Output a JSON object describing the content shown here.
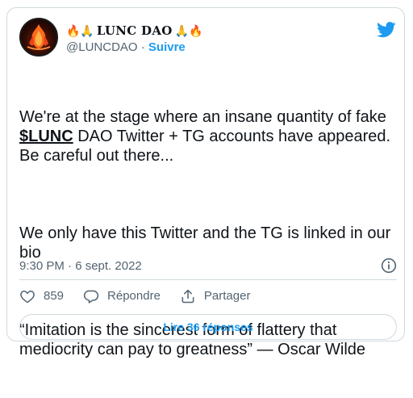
{
  "author": {
    "display_name": "LUNC DAO",
    "name_prefix_emoji": "🔥🙏",
    "name_suffix_emoji": "🙏🔥",
    "handle": "@LUNCDAO",
    "separator": "·",
    "follow_label": "Suivre"
  },
  "tweet": {
    "paragraph1_before": "We're at the stage where an insane quantity of fake ",
    "cashtag": "$LUNC",
    "paragraph1_after": " DAO Twitter + TG accounts have appeared. Be careful out there...",
    "paragraph2": "We only have this Twitter and the TG is linked in our bio",
    "paragraph3": "“Imitation is the sincerest form of flattery that mediocrity can pay to greatness” — Oscar Wilde",
    "timestamp": "9:30 PM · 6 sept. 2022"
  },
  "actions": {
    "like_count": "859",
    "reply_label": "Répondre",
    "share_label": "Partager"
  },
  "read_replies_label": "Lire 36 réponses",
  "colors": {
    "accent": "#1d9bf0",
    "text": "#0f1419",
    "muted": "#536471",
    "border": "#cfd9de"
  },
  "icons": [
    "twitter-bird-icon",
    "info-icon",
    "heart-icon",
    "reply-icon",
    "share-icon"
  ]
}
